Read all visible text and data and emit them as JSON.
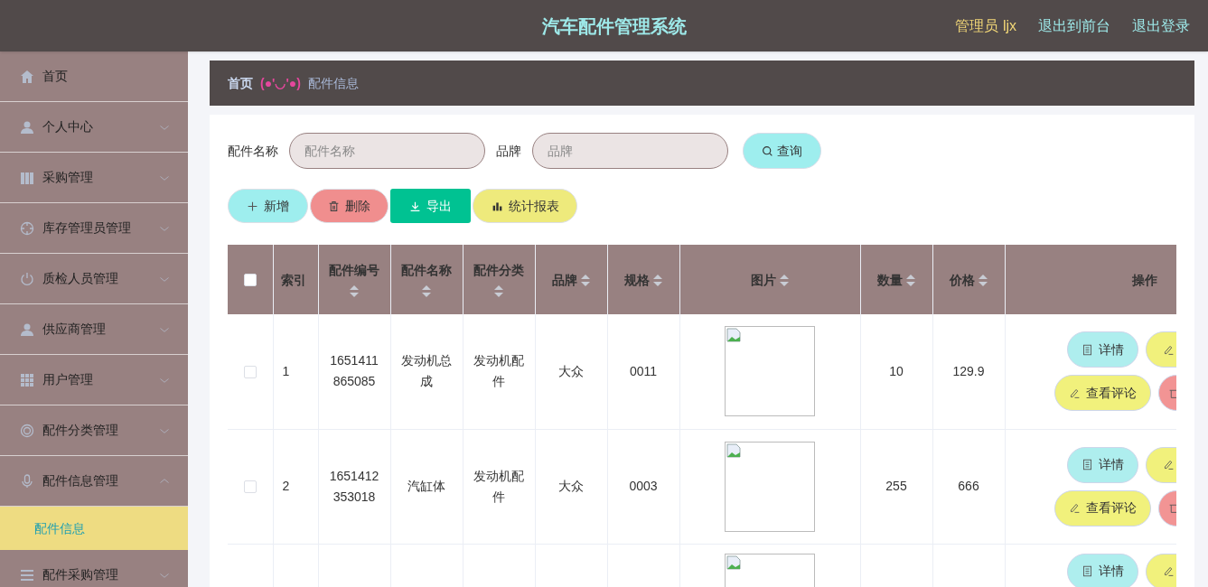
{
  "header": {
    "title": "汽车配件管理系统",
    "user": "管理员 ljx",
    "links": [
      "退出到前台",
      "退出登录"
    ]
  },
  "sidebar": {
    "items": [
      {
        "label": "首页",
        "kind": "link"
      },
      {
        "label": "个人中心",
        "kind": "submenu",
        "expanded": false
      },
      {
        "label": "采购管理",
        "kind": "submenu",
        "expanded": false
      },
      {
        "label": "库存管理员管理",
        "kind": "submenu",
        "expanded": false
      },
      {
        "label": "质检人员管理",
        "kind": "submenu",
        "expanded": false
      },
      {
        "label": "供应商管理",
        "kind": "submenu",
        "expanded": false
      },
      {
        "label": "用户管理",
        "kind": "submenu",
        "expanded": false
      },
      {
        "label": "配件分类管理",
        "kind": "submenu",
        "expanded": false
      },
      {
        "label": "配件信息管理",
        "kind": "submenu",
        "expanded": true,
        "children": [
          {
            "label": "配件信息",
            "selected": true
          }
        ]
      },
      {
        "label": "配件采购管理",
        "kind": "submenu",
        "expanded": false
      }
    ]
  },
  "breadcrumb": {
    "home": "首页",
    "separator": "(●'◡'●)",
    "current": "配件信息"
  },
  "search": {
    "fields": [
      {
        "label": "配件名称",
        "placeholder": "配件名称"
      },
      {
        "label": "品牌",
        "placeholder": "品牌"
      }
    ],
    "button": "查询"
  },
  "actions": [
    {
      "kind": "add",
      "label": "新增"
    },
    {
      "kind": "delete",
      "label": "删除"
    },
    {
      "kind": "export",
      "label": "导出"
    },
    {
      "kind": "report",
      "label": "统计报表"
    }
  ],
  "table": {
    "select_all": {
      "checked": false
    },
    "columns": [
      {
        "label": "索引",
        "sortable": false
      },
      {
        "label": "配件编号",
        "sortable": true
      },
      {
        "label": "配件名称",
        "sortable": true
      },
      {
        "label": "配件分类",
        "sortable": true
      },
      {
        "label": "品牌",
        "sortable": true
      },
      {
        "label": "规格",
        "sortable": true
      },
      {
        "label": "图片",
        "sortable": true
      },
      {
        "label": "数量",
        "sortable": true
      },
      {
        "label": "价格",
        "sortable": true
      },
      {
        "label": "操作",
        "sortable": false
      }
    ],
    "rows": [
      {
        "checked": false,
        "cells": [
          "1",
          "1651411865085",
          "发动机总成",
          "发动机配件",
          "大众",
          "0011",
          "",
          "10",
          "129.9"
        ],
        "actions": [
          {
            "kind": "detail",
            "label": "详情"
          },
          {
            "kind": "edit"
          },
          {
            "kind": "comment",
            "label": "查看评论"
          },
          {
            "kind": "delete"
          }
        ]
      },
      {
        "checked": false,
        "cells": [
          "2",
          "1651412353018",
          "汽缸体",
          "发动机配件",
          "大众",
          "0003",
          "",
          "255",
          "666"
        ],
        "actions": [
          {
            "kind": "detail",
            "label": "详情"
          },
          {
            "kind": "edit"
          },
          {
            "kind": "comment",
            "label": "查看评论"
          },
          {
            "kind": "delete"
          }
        ]
      },
      {
        "partial": true,
        "actions": [
          {
            "kind": "detail",
            "label": "详情"
          },
          {
            "kind": "edit"
          }
        ]
      }
    ]
  }
}
